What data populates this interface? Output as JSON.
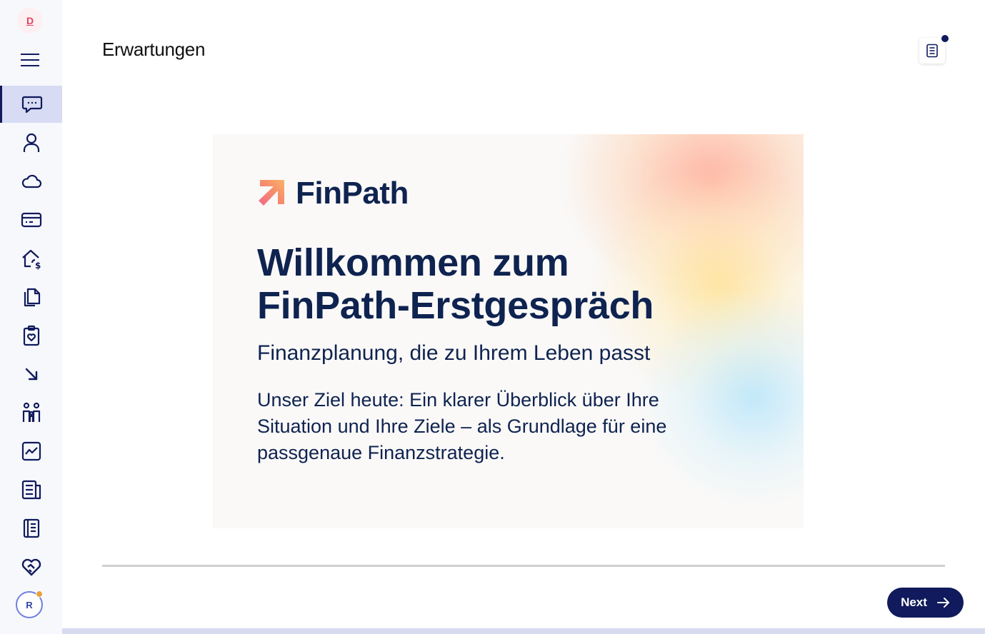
{
  "sidebar": {
    "brand_initial": "D",
    "avatar_initial": "R",
    "items": [
      {
        "name": "chat",
        "icon": "chat-bubble-icon",
        "active": true
      },
      {
        "name": "person",
        "icon": "person-icon"
      },
      {
        "name": "cloud",
        "icon": "cloud-icon"
      },
      {
        "name": "card",
        "icon": "credit-card-icon"
      },
      {
        "name": "house-dollar",
        "icon": "house-dollar-icon"
      },
      {
        "name": "documents",
        "icon": "documents-icon"
      },
      {
        "name": "clipboard-heart",
        "icon": "clipboard-heart-icon"
      },
      {
        "name": "arrow-down-right",
        "icon": "arrow-down-right-icon"
      },
      {
        "name": "family",
        "icon": "family-icon"
      },
      {
        "name": "chart",
        "icon": "line-chart-icon"
      },
      {
        "name": "list-document",
        "icon": "list-document-icon"
      },
      {
        "name": "notebook",
        "icon": "notebook-icon"
      },
      {
        "name": "handshake",
        "icon": "handshake-heart-icon"
      }
    ]
  },
  "header": {
    "title": "Erwartungen"
  },
  "slide": {
    "logo_text": "FinPath",
    "heading_line1": "Willkommen zum",
    "heading_line2": "FinPath-Erstgespräch",
    "subtitle": "Finanzplanung, die zu Ihrem Leben passt",
    "body": "Unser Ziel heute: Ein klarer Überblick über Ihre Situation und Ihre Ziele – als Grundlage für eine passgenaue Finanzstrategie."
  },
  "footer": {
    "next_label": "Next"
  },
  "colors": {
    "primary": "#101a5c",
    "slide_text": "#0f2350",
    "active_bg": "#d7dbf3",
    "accent_orange": "#e8a13a"
  }
}
